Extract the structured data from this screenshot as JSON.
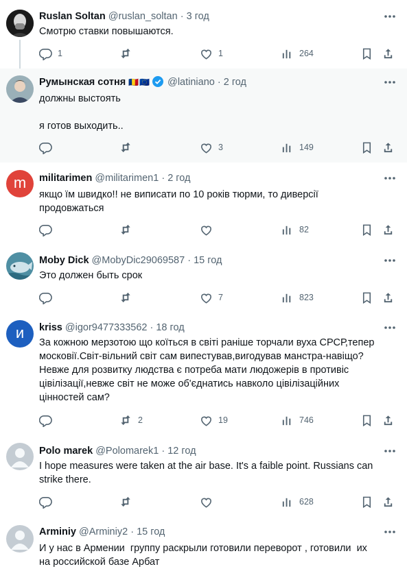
{
  "posts": [
    {
      "name": "Ruslan Soltan",
      "handle": "@ruslan_soltan",
      "time": "3 год",
      "text": "Смотрю ставки повышаются.",
      "replies": "1",
      "reposts": "",
      "likes": "1",
      "views": "264",
      "avatar": "photo-bald-man"
    },
    {
      "name": "Румынская сотня",
      "flags": "🇷🇴🇪🇺",
      "verified": true,
      "handle": "@latiniano",
      "time": "2 год",
      "text": "должны выстоять\n\nя готов выходить..",
      "replies": "",
      "reposts": "",
      "likes": "3",
      "views": "149",
      "avatar": "photo-person"
    },
    {
      "name": "militarimen",
      "handle": "@militarimen1",
      "time": "2 год",
      "text": "якщо їм швидко!! не виписати по 10 років тюрми, то диверсії\nпродовжаться",
      "replies": "",
      "reposts": "",
      "likes": "",
      "views": "82",
      "avatar": "letter",
      "avatar_letter": "m",
      "avatar_color": "#e0433a"
    },
    {
      "name": "Moby Dick",
      "handle": "@MobyDic29069587",
      "time": "15 год",
      "text": "Это должен быть срок",
      "replies": "",
      "reposts": "",
      "likes": "7",
      "views": "823",
      "avatar": "photo-whale"
    },
    {
      "name": "kriss",
      "handle": "@igor9477333562",
      "time": "18 год",
      "text": "За кожною мерзотою що коїться в світі раніше торчали вуха СРСР,тепер\nмосковії.Світ-вільний світ сам випестував,вигодував манстра-навіщо?\nНевже для розвитку людства є потреба мати людожерів в противіс\nцівілізації,невже світ не може об'єднатись навколо цівілізаційних\nцінностей сам?",
      "replies": "",
      "reposts": "2",
      "likes": "19",
      "views": "746",
      "avatar": "letter",
      "avatar_letter": "и",
      "avatar_color": "#1d5fbf"
    },
    {
      "name": "Polo marek",
      "handle": "@Polomarek1",
      "time": "12 год",
      "text": "I hope measures were taken at the air base. It's a faible point. Russians can\nstrike there.",
      "replies": "",
      "reposts": "",
      "likes": "",
      "views": "628",
      "avatar": "default"
    },
    {
      "name": "Arminiy",
      "handle": "@Arminiy2",
      "time": "15 год",
      "text": "И у нас в Армении  группу раскрыли готовили переворот , готовили  их\nна российской базе Арбат",
      "replies": "",
      "reposts": "",
      "likes": "",
      "views": "",
      "avatar": "default"
    }
  ],
  "separator": "·",
  "colors": {
    "text": "#0f1419",
    "secondary": "#536471",
    "verified": "#1d9bf0",
    "divider": "#eff3f4",
    "highlight": "#f7f9f9"
  }
}
